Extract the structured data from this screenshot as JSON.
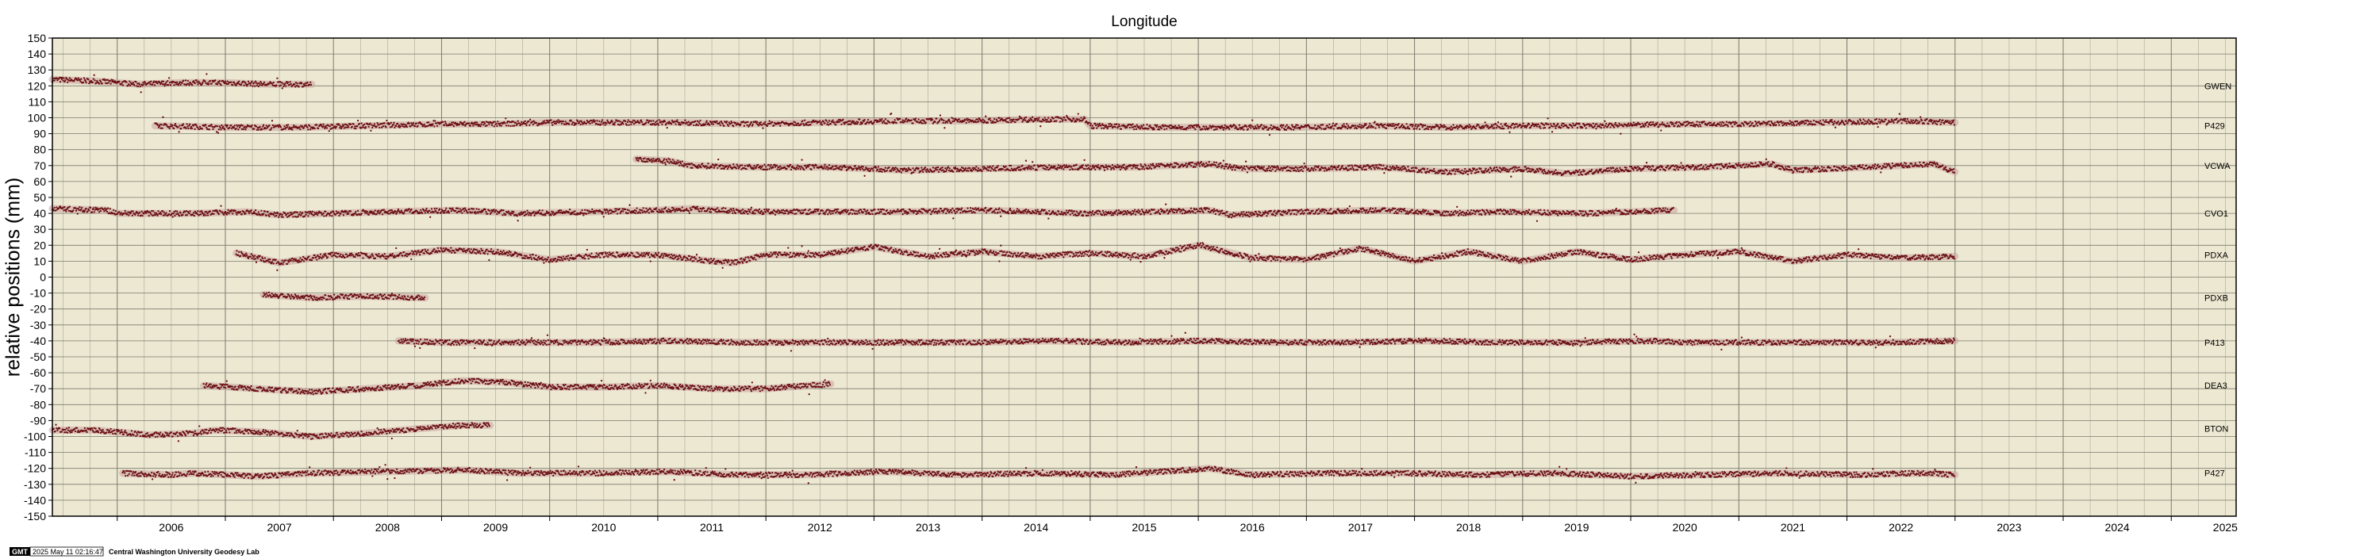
{
  "chart_data": {
    "type": "scatter",
    "title": "Longitude",
    "ylabel": "relative positions (mm)",
    "xlim": [
      2005.4,
      2025.6
    ],
    "ylim": [
      -150,
      150
    ],
    "x_ticks": [
      2006,
      2007,
      2008,
      2009,
      2010,
      2011,
      2012,
      2013,
      2014,
      2015,
      2016,
      2017,
      2018,
      2019,
      2020,
      2021,
      2022,
      2023,
      2024,
      2025
    ],
    "y_ticks": [
      150,
      140,
      130,
      120,
      110,
      100,
      90,
      80,
      70,
      60,
      50,
      40,
      30,
      20,
      10,
      0,
      -10,
      -20,
      -30,
      -40,
      -50,
      -60,
      -70,
      -80,
      -90,
      -100,
      -110,
      -120,
      -130,
      -140,
      -150
    ],
    "grid": true,
    "background_color": "#ede8d2",
    "point_color": "#6b0f12",
    "band_color": "#c9a3a0",
    "series": [
      {
        "name": "GWEN",
        "label_y": 120,
        "x": [
          2005.4,
          2005.8,
          2006.2,
          2006.6,
          2007.0,
          2007.4,
          2007.8
        ],
        "y": [
          124,
          123,
          121,
          122,
          122,
          121,
          121
        ]
      },
      {
        "name": "P429",
        "label_y": 95,
        "x": [
          2006.35,
          2007.0,
          2007.7,
          2008.3,
          2009.0,
          2009.5,
          2010.0,
          2010.6,
          2011.2,
          2011.8,
          2012.5,
          2013.2,
          2013.9,
          2014.5,
          2014.95,
          2015.0,
          2015.6,
          2016.2,
          2016.9,
          2017.6,
          2018.3,
          2019.0,
          2019.7,
          2020.4,
          2021.1,
          2021.8,
          2022.5,
          2023.0
        ],
        "y": [
          95,
          94,
          94,
          95,
          96,
          96,
          97,
          97,
          97,
          96,
          97,
          98,
          98,
          99,
          99,
          95,
          94,
          94,
          94,
          95,
          94,
          95,
          95,
          96,
          96,
          97,
          98,
          97
        ]
      },
      {
        "name": "VCWA",
        "label_y": 70,
        "x": [
          2010.8,
          2011.1,
          2011.3,
          2011.9,
          2012.6,
          2013.3,
          2014.0,
          2014.7,
          2015.4,
          2016.1,
          2016.4,
          2017.0,
          2017.7,
          2018.3,
          2019.0,
          2019.4,
          2020.0,
          2020.7,
          2021.3,
          2021.5,
          2022.2,
          2022.8,
          2023.0
        ],
        "y": [
          74,
          73,
          70,
          69,
          69,
          67,
          68,
          69,
          69,
          71,
          68,
          68,
          69,
          66,
          68,
          65,
          68,
          69,
          71,
          67,
          69,
          71,
          66
        ]
      },
      {
        "name": "CVO1",
        "label_y": 40,
        "x": [
          2005.4,
          2005.9,
          2006.0,
          2006.7,
          2007.2,
          2007.5,
          2008.0,
          2008.5,
          2009.15,
          2009.7,
          2010.4,
          2011.0,
          2011.3,
          2011.9,
          2012.6,
          2013.3,
          2014.0,
          2014.5,
          2014.95,
          2015.6,
          2016.1,
          2016.3,
          2017.0,
          2017.7,
          2018.3,
          2018.8,
          2019.6,
          2020.4
        ],
        "y": [
          43,
          42,
          40,
          40,
          41,
          39,
          40,
          41,
          42,
          40,
          41,
          42,
          43,
          41,
          41,
          41,
          42,
          41,
          40,
          41,
          42,
          39,
          41,
          42,
          40,
          41,
          40,
          42
        ]
      },
      {
        "name": "PDXA",
        "label_y": 14,
        "x": [
          2007.1,
          2007.5,
          2008.0,
          2008.5,
          2009.0,
          2009.5,
          2010.0,
          2010.5,
          2011.0,
          2011.5,
          2011.7,
          2012.0,
          2012.5,
          2013.0,
          2013.5,
          2014.0,
          2014.5,
          2015.0,
          2015.5,
          2016.0,
          2016.5,
          2017.0,
          2017.5,
          2018.0,
          2018.5,
          2019.0,
          2019.5,
          2020.0,
          2020.5,
          2021.0,
          2021.5,
          2022.0,
          2022.5,
          2023.0
        ],
        "y": [
          15,
          9,
          14,
          13,
          17,
          16,
          11,
          14,
          14,
          10,
          9,
          14,
          14,
          19,
          13,
          16,
          13,
          15,
          13,
          20,
          12,
          11,
          18,
          10,
          16,
          10,
          16,
          11,
          14,
          16,
          10,
          14,
          12,
          13
        ]
      },
      {
        "name": "PDXB",
        "label_y": -13,
        "x": [
          2007.35,
          2007.8,
          2008.3,
          2008.85
        ],
        "y": [
          -11,
          -13,
          -12,
          -13
        ]
      },
      {
        "name": "P413",
        "label_y": -41,
        "x": [
          2008.6,
          2009.0,
          2009.7,
          2010.4,
          2011.1,
          2011.8,
          2012.5,
          2013.2,
          2013.9,
          2014.6,
          2015.3,
          2016.0,
          2016.7,
          2017.4,
          2018.1,
          2018.8,
          2019.5,
          2020.2,
          2020.45,
          2021.0,
          2021.7,
          2022.4,
          2023.0
        ],
        "y": [
          -40,
          -41,
          -41,
          -41,
          -40,
          -41,
          -41,
          -41,
          -41,
          -40,
          -41,
          -40,
          -41,
          -41,
          -40,
          -41,
          -41,
          -40,
          -41,
          -41,
          -41,
          -41,
          -40
        ]
      },
      {
        "name": "DEA3",
        "label_y": -68,
        "x": [
          2006.8,
          2007.3,
          2007.8,
          2008.3,
          2008.8,
          2009.2,
          2009.6,
          2010.0,
          2010.5,
          2011.0,
          2011.5,
          2012.0,
          2012.4,
          2012.6
        ],
        "y": [
          -68,
          -70,
          -72,
          -70,
          -68,
          -65,
          -66,
          -69,
          -69,
          -68,
          -70,
          -70,
          -68,
          -67
        ]
      },
      {
        "name": "BTON",
        "label_y": -95,
        "x": [
          2005.4,
          2005.8,
          2006.3,
          2006.7,
          2006.9,
          2007.3,
          2007.8,
          2008.3,
          2008.8,
          2009.2,
          2009.45
        ],
        "y": [
          -96,
          -96,
          -99,
          -98,
          -96,
          -97,
          -100,
          -98,
          -95,
          -93,
          -93
        ]
      },
      {
        "name": "P427",
        "label_y": -123,
        "x": [
          2006.05,
          2006.5,
          2006.7,
          2007.3,
          2007.8,
          2008.5,
          2009.2,
          2009.7,
          2010.4,
          2011.1,
          2011.7,
          2012.4,
          2013.1,
          2013.8,
          2014.5,
          2015.2,
          2015.9,
          2016.1,
          2016.5,
          2017.2,
          2017.9,
          2018.6,
          2019.3,
          2020.0,
          2020.7,
          2021.4,
          2022.1,
          2022.7,
          2023.0
        ],
        "y": [
          -123,
          -124,
          -123,
          -125,
          -123,
          -122,
          -121,
          -123,
          -123,
          -122,
          -124,
          -124,
          -122,
          -124,
          -123,
          -124,
          -121,
          -120,
          -124,
          -123,
          -123,
          -124,
          -123,
          -125,
          -124,
          -123,
          -124,
          -123,
          -124
        ]
      }
    ]
  },
  "footer": {
    "logo": "GMT",
    "timestamp": "2025 May 11 02:16:47",
    "credit": "Central Washington University Geodesy Lab"
  }
}
